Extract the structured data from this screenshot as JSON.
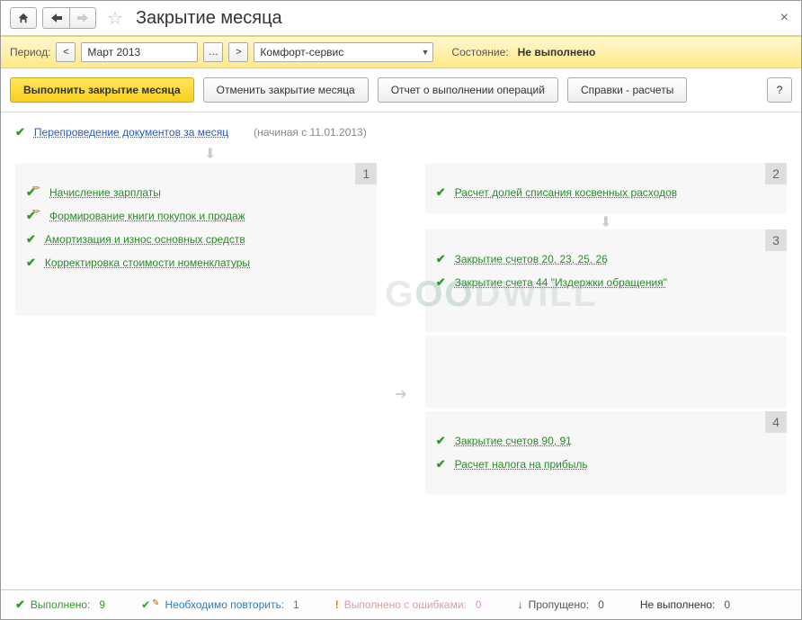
{
  "title": "Закрытие месяца",
  "period": {
    "label": "Период:",
    "value": "Март 2013"
  },
  "org": {
    "value": "Комфорт-сервис"
  },
  "status": {
    "label": "Состояние:",
    "value": "Не выполнено"
  },
  "actions": {
    "execute": "Выполнить закрытие месяца",
    "cancel": "Отменить закрытие месяца",
    "report": "Отчет о выполнении операций",
    "refs": "Справки - расчеты",
    "help": "?"
  },
  "reprov": {
    "label": "Перепроведение документов за месяц",
    "note": "(начиная с 11.01.2013)"
  },
  "groups": {
    "g1": {
      "num": "1",
      "ops": [
        "Начисление зарплаты",
        "Формирование книги покупок и продаж",
        "Амортизация и износ основных средств",
        "Корректировка стоимости номенклатуры"
      ]
    },
    "g2": {
      "num": "2",
      "ops": [
        "Расчет долей списания косвенных расходов"
      ]
    },
    "g3": {
      "num": "3",
      "ops": [
        "Закрытие счетов 20, 23, 25, 26",
        "Закрытие счета 44 \"Издержки обращения\""
      ]
    },
    "g4": {
      "num": "4",
      "ops": [
        "Закрытие счетов 90, 91",
        "Расчет налога на прибыль"
      ]
    }
  },
  "footer": {
    "done_label": "Выполнено:",
    "done_count": "9",
    "repeat_label": "Необходимо повторить:",
    "repeat_count": "1",
    "error_label": "Выполнено с ошибками:",
    "error_count": "0",
    "skip_label": "Пропущено:",
    "skip_count": "0",
    "notdone_label": "Не выполнено:",
    "notdone_count": "0"
  },
  "watermark": "GOODWILL"
}
